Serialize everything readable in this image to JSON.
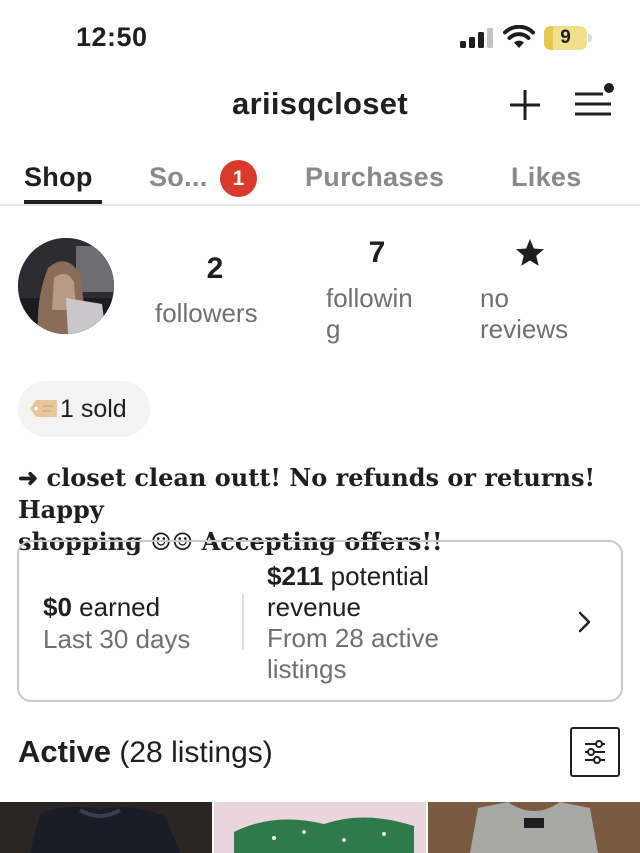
{
  "status_bar": {
    "time": "12:50",
    "battery_level": "9",
    "icons": [
      "signal-icon",
      "wifi-icon",
      "battery-icon"
    ]
  },
  "header": {
    "username": "ariisqcloset",
    "icons": [
      "plus-icon",
      "menu-icon"
    ]
  },
  "tabs": [
    {
      "label": "Shop",
      "active": true
    },
    {
      "label": "So...",
      "badge": "1",
      "active": false
    },
    {
      "label": "Purchases",
      "active": false
    },
    {
      "label": "Likes",
      "active": false
    }
  ],
  "profile": {
    "followers_count": "2",
    "followers_label": "followers",
    "following_count": "7",
    "following_label_line1": "followin",
    "following_label_line2": "g",
    "reviews_icon": "star-icon",
    "reviews_label_line1": "no",
    "reviews_label_line2": "reviews"
  },
  "sold_chip": {
    "icon": "price-tag-icon",
    "text": "1 sold"
  },
  "bio": {
    "line1": "➜ closet clean outt! No refunds or returns! Happy",
    "line2": "shopping ☺☺ Accepting offers!!"
  },
  "earnings_card": {
    "earned_amount": "$0",
    "earned_label": " earned",
    "earned_period": "Last 30 days",
    "revenue_amount": "$211",
    "revenue_label": " potential revenue",
    "revenue_source": "From 28 active listings"
  },
  "active_section": {
    "title": "Active",
    "count": " (28 listings)"
  },
  "colors": {
    "badge": "#d93a2b",
    "battery": "#f0e08c",
    "text_primary": "#1f1f1f",
    "text_secondary": "#707070"
  }
}
